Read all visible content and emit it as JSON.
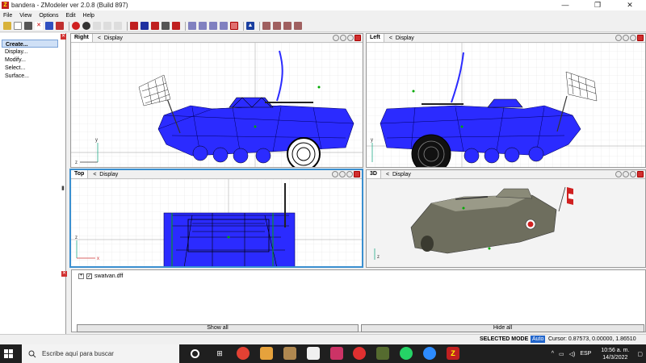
{
  "window": {
    "title": "bandera - ZModeler ver 2.0.8 (Build 897)",
    "min": "—",
    "max": "❐",
    "close": "✕"
  },
  "menu": [
    "File",
    "View",
    "Options",
    "Edit",
    "Help"
  ],
  "left_panel": {
    "items": [
      "Create...",
      "Display...",
      "Modify...",
      "Select...",
      "Surface..."
    ]
  },
  "viewports": {
    "right": {
      "label": "Right",
      "display": "Display"
    },
    "left": {
      "label": "Left",
      "display": "Display"
    },
    "top": {
      "label": "Top",
      "display": "Display"
    },
    "view3d": {
      "label": "3D",
      "display": "Display"
    }
  },
  "axes": {
    "x": "x",
    "y": "y",
    "z": "z"
  },
  "bottom_panel": {
    "file": "swatvan.dff",
    "show_all": "Show all",
    "hide_all": "Hide all"
  },
  "status": {
    "mode": "SELECTED MODE",
    "auto": "Auto",
    "cursor": "Cursor: 0.87573, 0.00000, 1.86510"
  },
  "taskbar": {
    "search_placeholder": "Escribe aquí para buscar",
    "lang": "ESP",
    "time": "10:56 a. m.",
    "date": "14/3/2022"
  },
  "colors": {
    "mesh": "#2b2bff",
    "accent": "#3a8fd0",
    "taskbar": "#1f1f1f"
  }
}
